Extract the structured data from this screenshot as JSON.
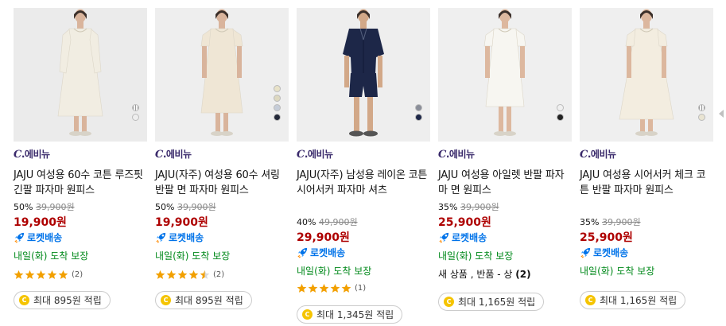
{
  "products": [
    {
      "brand": "에비뉴",
      "title": "JAJU 여성용 60수 코튼 루즈핏 긴팔 파자마 원피스",
      "discount": "50%",
      "original_price": "39,900원",
      "price": "19,900원",
      "delivery": "로켓배송",
      "arrival": "내일(화) 도착 보장",
      "rating_stars": 5,
      "review_count": "(2)",
      "reward": "최대 895원 적립",
      "image": {
        "bg": "#ebebeb",
        "garment": "#f1ede2",
        "skin": "#d9b49c",
        "pose": "dress-long-sleeve"
      },
      "swatches": [
        {
          "type": "multi"
        },
        {
          "type": "color",
          "color": "#eeeeee"
        }
      ]
    },
    {
      "brand": "에비뉴",
      "title": "JAJU(자주) 여성용 60수 셔링 반팔 면 파자마 원피스",
      "discount": "50%",
      "original_price": "39,900원",
      "price": "19,900원",
      "delivery": "로켓배송",
      "arrival": "내일(화) 도착 보장",
      "rating_stars": 4.5,
      "review_count": "(2)",
      "reward": "최대 895원 적립",
      "image": {
        "bg": "#eeeeee",
        "garment": "#efe6d5",
        "skin": "#d9b49c",
        "pose": "dress-short-sleeve"
      },
      "swatches": [
        {
          "type": "color",
          "color": "#e8e2c8"
        },
        {
          "type": "color",
          "color": "#ddd8c0"
        },
        {
          "type": "color",
          "color": "#c5ccd8"
        },
        {
          "type": "color",
          "color": "#232838"
        }
      ]
    },
    {
      "brand": "에비뉴",
      "title": "JAJU(자주) 남성용 레이온 코튼 시어서커 파자마 셔츠",
      "discount": "40%",
      "original_price": "49,900원",
      "price": "29,900원",
      "delivery": "로켓배송",
      "arrival": "내일(화) 도착 보장",
      "rating_stars": 5,
      "review_count": "(1)",
      "reward": "최대 1,345원 적립",
      "image": {
        "bg": "#eeeeee",
        "garment": "#1d2748",
        "skin": "#d2a888",
        "pose": "shirt-shorts"
      },
      "swatches": [
        {
          "type": "color",
          "color": "#8a8e99"
        },
        {
          "type": "color",
          "color": "#1d2748"
        }
      ]
    },
    {
      "brand": "에비뉴",
      "title": "JAJU 여성용 아일렛 반팔 파자마 면 원피스",
      "discount": "35%",
      "original_price": "39,900원",
      "price": "25,900원",
      "delivery": "로켓배송",
      "arrival": "내일(화) 도착 보장",
      "subtitle": "새 상품 , 반품 - 상",
      "subtitle_count": "(2)",
      "reward": "최대 1,165원 적립",
      "image": {
        "bg": "#efefef",
        "garment": "#f7f6f1",
        "skin": "#ddb89f",
        "pose": "dress-knee"
      },
      "swatches": [
        {
          "type": "color",
          "color": "#f0f0f0"
        },
        {
          "type": "color",
          "color": "#222222"
        }
      ]
    },
    {
      "brand": "에비뉴",
      "title": "JAJU 여성용 시어서커 체크 코튼 반팔 파자마 원피스",
      "discount": "35%",
      "original_price": "39,900원",
      "price": "25,900원",
      "delivery": "로켓배송",
      "arrival": "내일(화) 도착 보장",
      "reward": "최대 1,165원 적립",
      "image": {
        "bg": "#efefef",
        "garment": "#f3ede0",
        "skin": "#dcb79e",
        "pose": "dress-wide"
      },
      "swatches": [
        {
          "type": "multi"
        },
        {
          "type": "color",
          "color": "#e9e4d2"
        }
      ]
    }
  ]
}
